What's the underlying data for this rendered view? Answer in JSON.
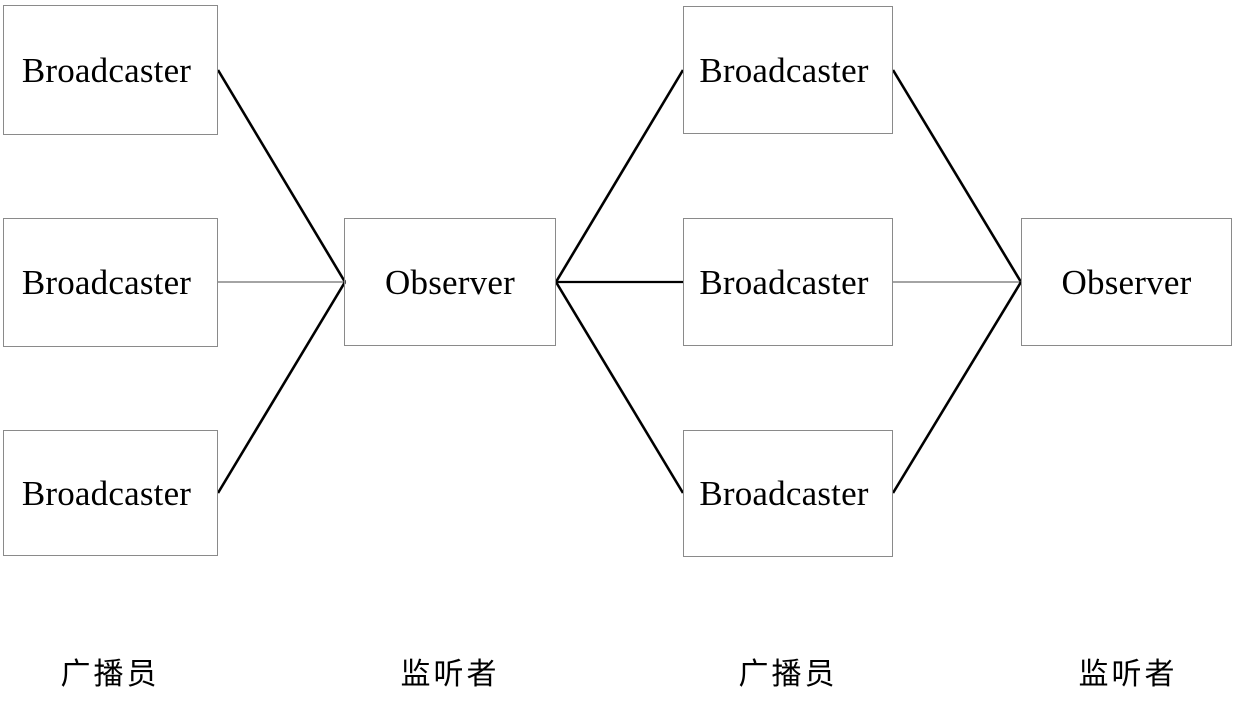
{
  "diagram": {
    "type": "flow-diagram",
    "background_color": "#ffffff",
    "box_border_color": "#8a8a8a",
    "connector_color": "#000000",
    "thin_connector_color": "#6e6e6e",
    "groups": [
      {
        "id": "group-1",
        "broadcasters": [
          {
            "label": "Broadcaster"
          },
          {
            "label": "Broadcaster"
          },
          {
            "label": "Broadcaster"
          }
        ],
        "observer": {
          "label": "Observer"
        }
      },
      {
        "id": "group-2",
        "broadcasters": [
          {
            "label": "Broadcaster"
          },
          {
            "label": "Broadcaster"
          },
          {
            "label": "Broadcaster"
          }
        ],
        "observer": {
          "label": "Observer"
        }
      }
    ],
    "captions": [
      {
        "text": "广播员"
      },
      {
        "text": "监听者"
      },
      {
        "text": "广播员"
      },
      {
        "text": "监听者"
      }
    ]
  }
}
